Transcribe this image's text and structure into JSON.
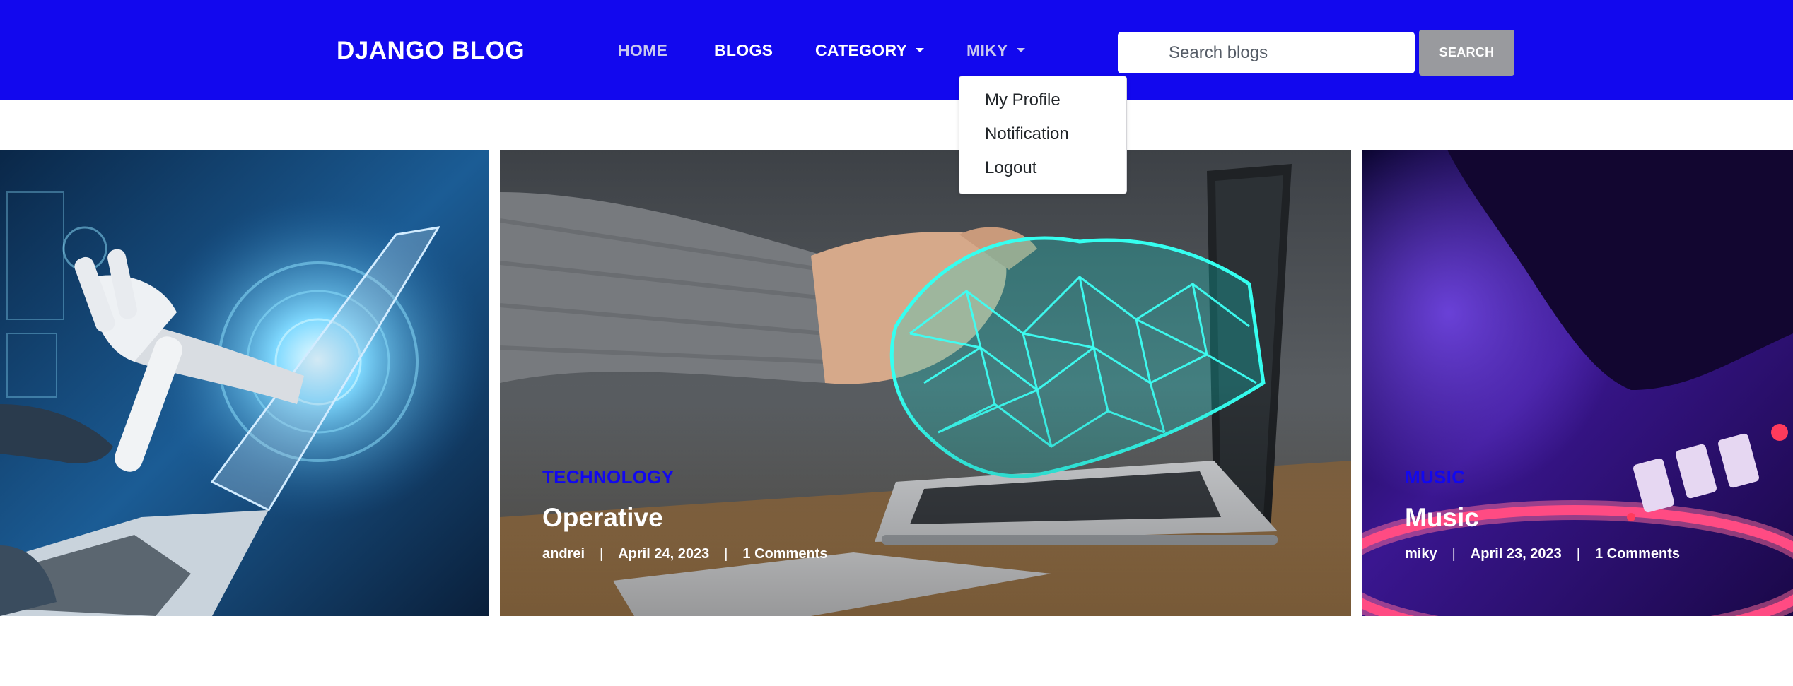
{
  "navbar": {
    "brand": "DJANGO BLOG",
    "links": {
      "home": "HOME",
      "blogs": "BLOGS",
      "category": "CATEGORY",
      "user": "MIKY"
    },
    "search": {
      "placeholder": "Search blogs",
      "value": "",
      "button_label": "SEARCH"
    },
    "colors": {
      "background": "#1208ee",
      "search_button": "#999a9e"
    }
  },
  "user_dropdown": {
    "items": [
      "My Profile",
      "Notification",
      "Logout"
    ]
  },
  "slider": {
    "slides": [
      {
        "image": "robot-hand-touching-laptop-image"
      },
      {
        "image": "human-hand-shaking-digital-hand-from-laptop-image",
        "category": "TECHNOLOGY",
        "title": "Operative",
        "author": "andrei",
        "date": "April 24, 2023",
        "comments": "1 Comments"
      },
      {
        "image": "dj-mixer-purple-lights-image",
        "category": "MUSIC",
        "title": "Music",
        "author": "miky",
        "date": "April 23, 2023",
        "comments": "1 Comments"
      }
    ],
    "colors": {
      "category_text": "#1208ee"
    }
  }
}
